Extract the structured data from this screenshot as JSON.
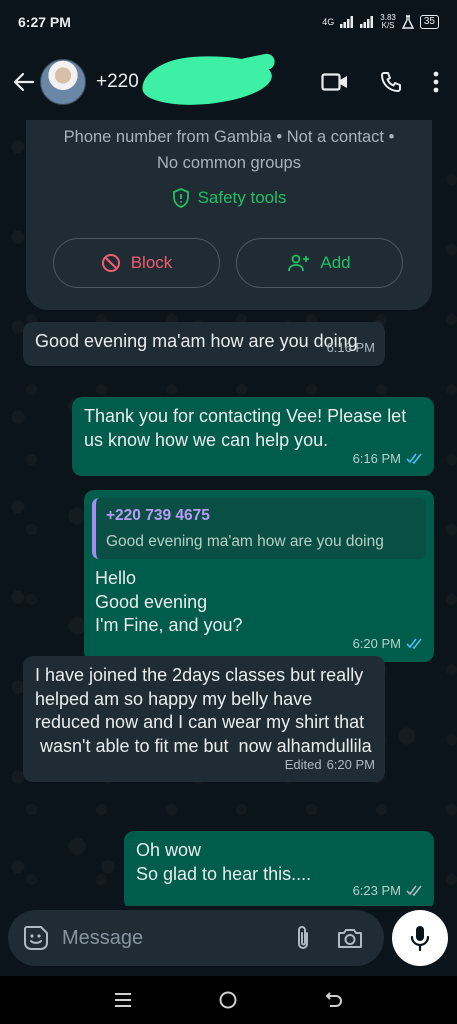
{
  "status_bar": {
    "time": "6:27 PM",
    "network": "4G",
    "speed": "3.83",
    "speed_unit": "K/S",
    "battery": "35"
  },
  "header": {
    "contact_name": "+220",
    "icons": [
      "back-arrow-icon",
      "video-call-icon",
      "voice-call-icon",
      "more-options-icon"
    ]
  },
  "info_card": {
    "text": "Phone number from Gambia • Not a contact • No common groups",
    "safety_label": "Safety tools",
    "block_label": "Block",
    "add_label": "Add"
  },
  "messages": [
    {
      "direction": "in",
      "text": "Good evening ma'am  how are you doing",
      "time": "6:16 PM"
    },
    {
      "direction": "out",
      "text": "Thank you for contacting Vee! Please let us know how we can help you.",
      "time": "6:16 PM",
      "read": true
    },
    {
      "direction": "out",
      "quote_name": "+220 739 4675",
      "quote_text": "Good evening ma'am  how are you doing",
      "lines": [
        "Hello",
        "Good evening",
        "I'm Fine, and you?"
      ],
      "time": "6:20 PM",
      "read": true
    },
    {
      "direction": "in",
      "lines": [
        "I have joined the 2days classes but really helped am so happy my belly have reduced now and I can wear my shirt that",
        " wasn't able to fit me but  now alhamdullila"
      ],
      "edited": "Edited",
      "time": "6:20 PM"
    },
    {
      "direction": "out",
      "lines": [
        "Oh wow",
        "So glad to hear this...."
      ],
      "time": "6:23 PM",
      "read": false
    }
  ],
  "composer": {
    "placeholder": "Message"
  },
  "colors": {
    "background": "#0b141a",
    "incoming_bubble": "#202c33",
    "outgoing_bubble": "#005c4b",
    "accent_green": "#21c063",
    "danger_red": "#f15c6d",
    "read_tick_blue": "#53bdeb"
  }
}
